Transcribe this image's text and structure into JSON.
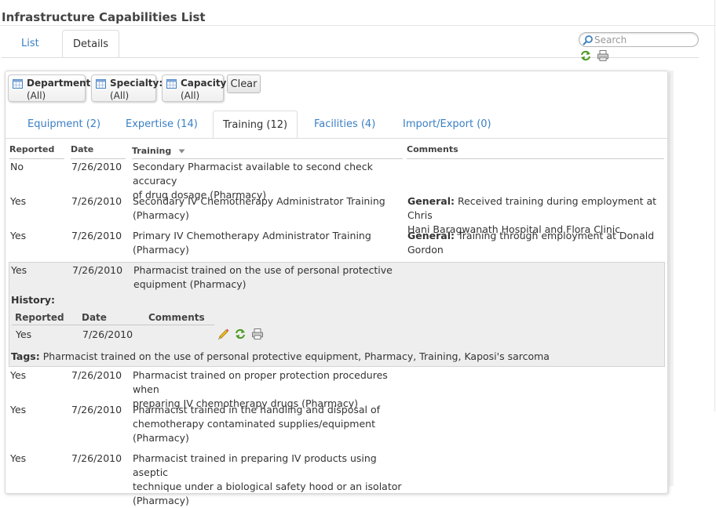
{
  "page": {
    "title": "Infrastructure Capabilities List"
  },
  "top_tabs": [
    {
      "label": "List"
    },
    {
      "label": "Details"
    }
  ],
  "search": {
    "placeholder": "Search",
    "value": ""
  },
  "filters": [
    {
      "label": "Department:",
      "value": "(All)"
    },
    {
      "label": "Specialty:",
      "value": "(All)"
    },
    {
      "label": "Capacity:",
      "value": "(All)"
    }
  ],
  "clear_label": "Clear",
  "sub_tabs": [
    {
      "label": "Equipment (2)"
    },
    {
      "label": "Expertise (14)"
    },
    {
      "label": "Training (12)"
    },
    {
      "label": "Facilities (4)"
    },
    {
      "label": "Import/Export (0)"
    }
  ],
  "active_sub_tab": "Training (12)",
  "columns": {
    "reported": "Reported",
    "date": "Date",
    "training": "Training",
    "comments": "Comments"
  },
  "sort": {
    "column": "Training",
    "direction": "descending"
  },
  "rows": [
    {
      "reported": "No",
      "date": "7/26/2010",
      "training": [
        "Secondary Pharmacist available to second check accuracy",
        "of drug dosage (Pharmacy)"
      ],
      "comment_label": "",
      "comments": []
    },
    {
      "reported": "Yes",
      "date": "7/26/2010",
      "training": [
        "Secondary IV Chemotherapy Administrator Training",
        "(Pharmacy)"
      ],
      "comment_label": "General:",
      "comments": [
        "Received training during employment at Chris",
        "Hani Baragwanath Hospital and Flora Clinic"
      ]
    },
    {
      "reported": "Yes",
      "date": "7/26/2010",
      "training": [
        "Primary IV Chemotherapy Administrator Training",
        "(Pharmacy)"
      ],
      "comment_label": "General:",
      "comments": [
        "Training through employment at Donald",
        "Gordon"
      ]
    },
    {
      "reported": "Yes",
      "date": "7/26/2010",
      "training": [
        "Pharmacist trained on the use of personal protective",
        "equipment (Pharmacy)"
      ],
      "comment_label": "",
      "comments": [],
      "expanded": true
    },
    {
      "reported": "Yes",
      "date": "7/26/2010",
      "training": [
        "Pharmacist trained on proper protection procedures when",
        "preparing IV chemotherapy drugs (Pharmacy)"
      ],
      "comment_label": "",
      "comments": []
    },
    {
      "reported": "Yes",
      "date": "7/26/2010",
      "training": [
        "Pharmacist trained in the handling and disposal of",
        "chemotherapy contaminated supplies/equipment",
        "(Pharmacy)"
      ],
      "comment_label": "",
      "comments": []
    },
    {
      "reported": "Yes",
      "date": "7/26/2010",
      "training": [
        "Pharmacist trained in preparing IV products using aseptic",
        "technique under a biological safety hood or an isolator",
        "(Pharmacy)"
      ],
      "comment_label": "",
      "comments": []
    }
  ],
  "history": {
    "label": "History:",
    "columns": {
      "reported": "Reported",
      "date": "Date",
      "comments": "Comments"
    },
    "rows": [
      {
        "reported": "Yes",
        "date": "7/26/2010",
        "comments": ""
      }
    ]
  },
  "tags": {
    "label": "Tags:",
    "text": "Pharmacist trained on the use of personal protective equipment, Pharmacy, Training, Kaposi's sarcoma"
  },
  "icons": {
    "search": "search-icon",
    "refresh": "refresh-icon",
    "print": "print-icon",
    "edit": "pencil-icon",
    "filter": "calendar-grid-icon",
    "sort": "sort-down-icon"
  },
  "colors": {
    "link": "#3b7fc4",
    "highlight_row": "#eeeeee",
    "text": "#333333"
  }
}
